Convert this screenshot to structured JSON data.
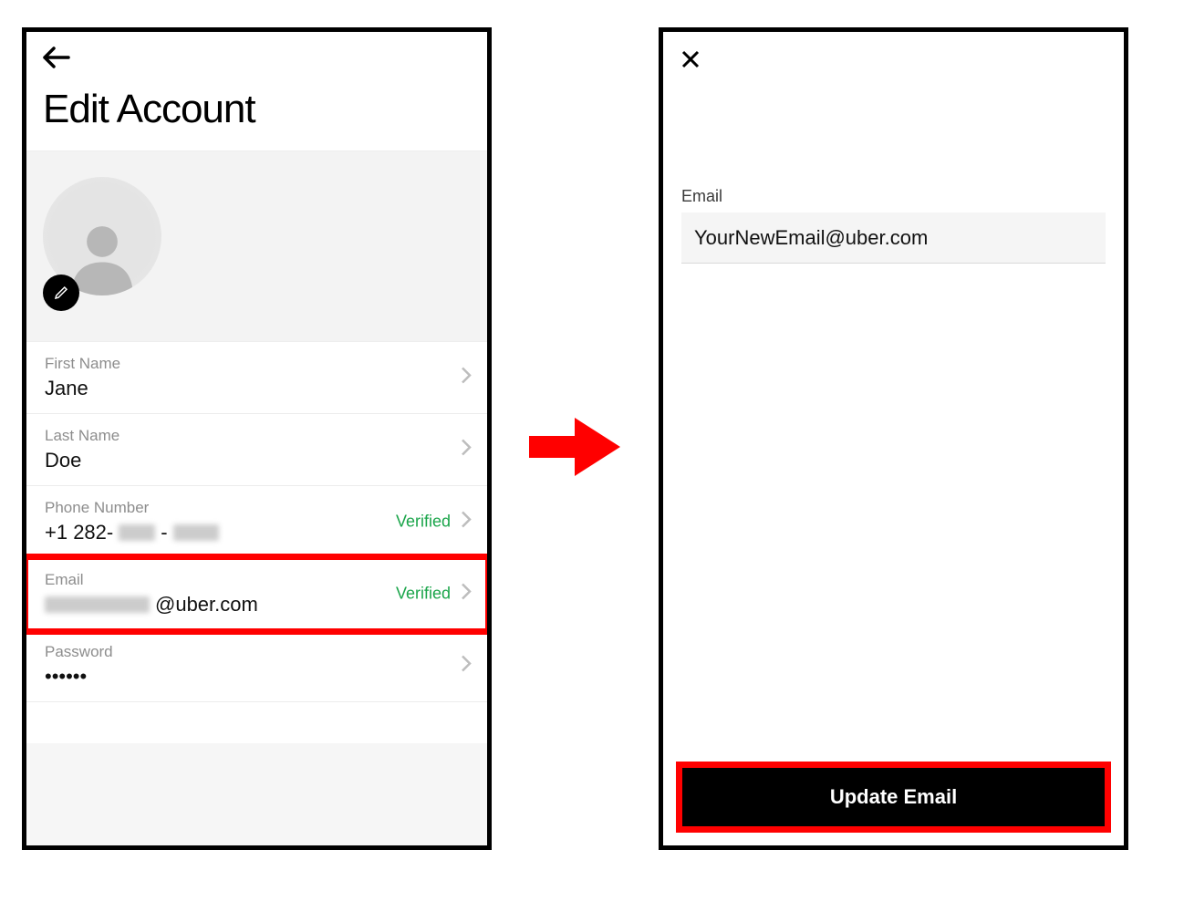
{
  "left": {
    "title": "Edit Account",
    "fields": {
      "first_name": {
        "label": "First Name",
        "value": "Jane"
      },
      "last_name": {
        "label": "Last Name",
        "value": "Doe"
      },
      "phone": {
        "label": "Phone Number",
        "prefix": "+1 282-",
        "status": "Verified"
      },
      "email": {
        "label": "Email",
        "suffix": "@uber.com",
        "status": "Verified"
      },
      "password": {
        "label": "Password",
        "value": "••••••"
      }
    }
  },
  "right": {
    "email_label": "Email",
    "email_value": "YourNewEmail@uber.com",
    "update_button": "Update Email"
  }
}
